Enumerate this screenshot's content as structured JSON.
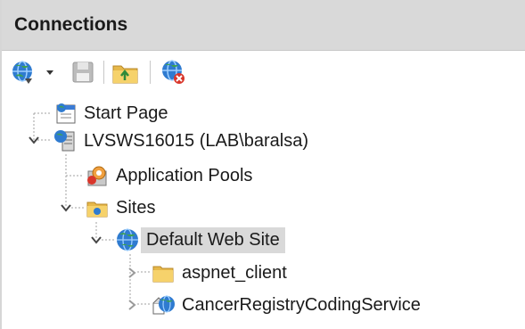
{
  "panel": {
    "title": "Connections"
  },
  "toolbar": {
    "buttons": [
      {
        "name": "connect",
        "icon": "globe-connect-icon",
        "has_dropdown": true
      },
      {
        "name": "save",
        "icon": "save-icon",
        "disabled": true
      },
      {
        "name": "up-folder",
        "icon": "folder-up-icon"
      },
      {
        "name": "disconnect",
        "icon": "globe-disconnect-icon"
      }
    ]
  },
  "tree": {
    "start_page": "Start Page",
    "server": "LVSWS16015 (LAB\\baralsa)",
    "app_pools": "Application Pools",
    "sites": "Sites",
    "default_site": "Default Web Site",
    "child_folder": "aspnet_client",
    "child_app": "CancerRegistryCodingService"
  },
  "colors": {
    "header_bg": "#d9d9d9",
    "selection_bg": "#d9d9d9",
    "tree_line": "#a0a0a0"
  }
}
